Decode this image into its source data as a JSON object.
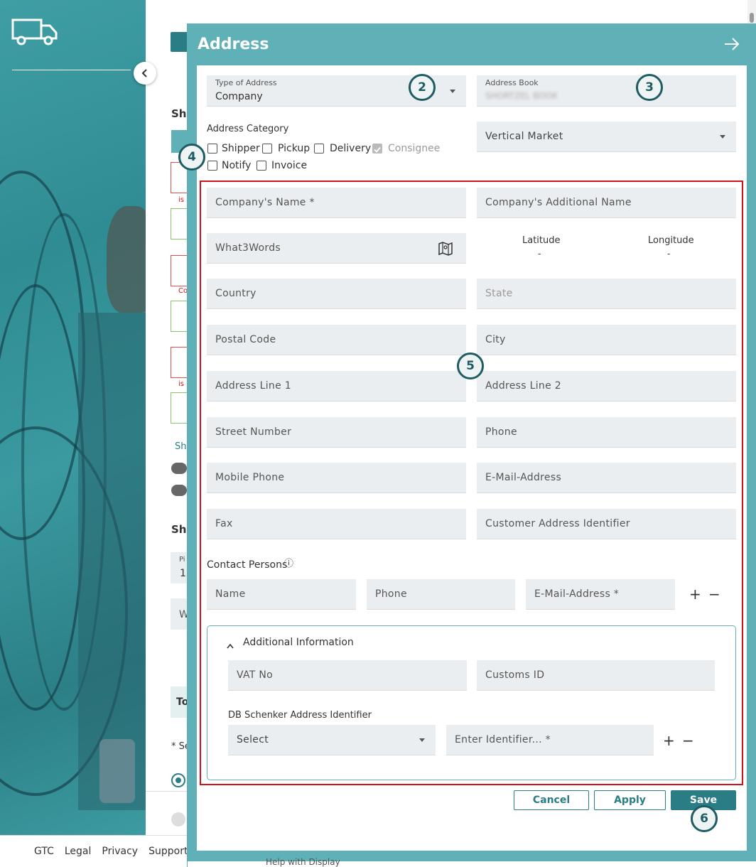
{
  "footer": {
    "links": [
      "GTC",
      "Legal",
      "Privacy",
      "Support"
    ]
  },
  "background": {
    "fragments": [
      "Shi",
      "is",
      "Co",
      "Sh",
      "Shi",
      "Pi",
      "1",
      "W",
      "To",
      "* Se"
    ],
    "partial_bottom_text": [
      "Help with Display"
    ]
  },
  "panel": {
    "title": "Address",
    "type_of_address": {
      "label": "Type of Address",
      "value": "Company"
    },
    "address_book": {
      "label": "Address Book",
      "value": "SHORTZEL BOOK"
    },
    "address_category": {
      "label": "Address Category",
      "options": [
        {
          "label": "Shipper",
          "checked": false,
          "disabled": false
        },
        {
          "label": "Pickup",
          "checked": false,
          "disabled": false
        },
        {
          "label": "Delivery",
          "checked": false,
          "disabled": false
        },
        {
          "label": "Consignee",
          "checked": true,
          "disabled": true
        },
        {
          "label": "Notify",
          "checked": false,
          "disabled": false
        },
        {
          "label": "Invoice",
          "checked": false,
          "disabled": false
        }
      ]
    },
    "vertical_market": {
      "placeholder": "Vertical Market"
    },
    "fields": {
      "company_name": "Company's Name *",
      "company_additional_name": "Company's Additional Name",
      "what3words": "What3Words",
      "latitude_label": "Latitude",
      "latitude_value": "-",
      "longitude_label": "Longitude",
      "longitude_value": "-",
      "country": "Country",
      "state": "State",
      "postal_code": "Postal Code",
      "city": "City",
      "address_line_1": "Address Line 1",
      "address_line_2": "Address Line 2",
      "street_number": "Street Number",
      "phone": "Phone",
      "mobile_phone": "Mobile Phone",
      "email": "E-Mail-Address",
      "fax": "Fax",
      "customer_address_identifier": "Customer Address Identifier"
    },
    "contact_persons": {
      "label": "Contact Persons",
      "info_icon": "ⓘ",
      "name": "Name",
      "phone": "Phone",
      "email": "E-Mail-Address *",
      "add": "+",
      "remove": "−"
    },
    "additional_information": {
      "label": "Additional Information",
      "vat_no": "VAT No",
      "customs_id": "Customs ID",
      "db_schenker_label": "DB Schenker Address Identifier",
      "select": "Select",
      "identifier": "Enter Identifier... *",
      "add": "+",
      "remove": "−"
    },
    "buttons": {
      "cancel": "Cancel",
      "apply": "Apply",
      "save": "Save"
    }
  },
  "badges": [
    "2",
    "3",
    "4",
    "5",
    "6"
  ],
  "colors": {
    "teal": "#5fb0b7",
    "dark_teal": "#2a7d85",
    "highlight_red": "#d0121b",
    "badge": "#1e5c63"
  }
}
